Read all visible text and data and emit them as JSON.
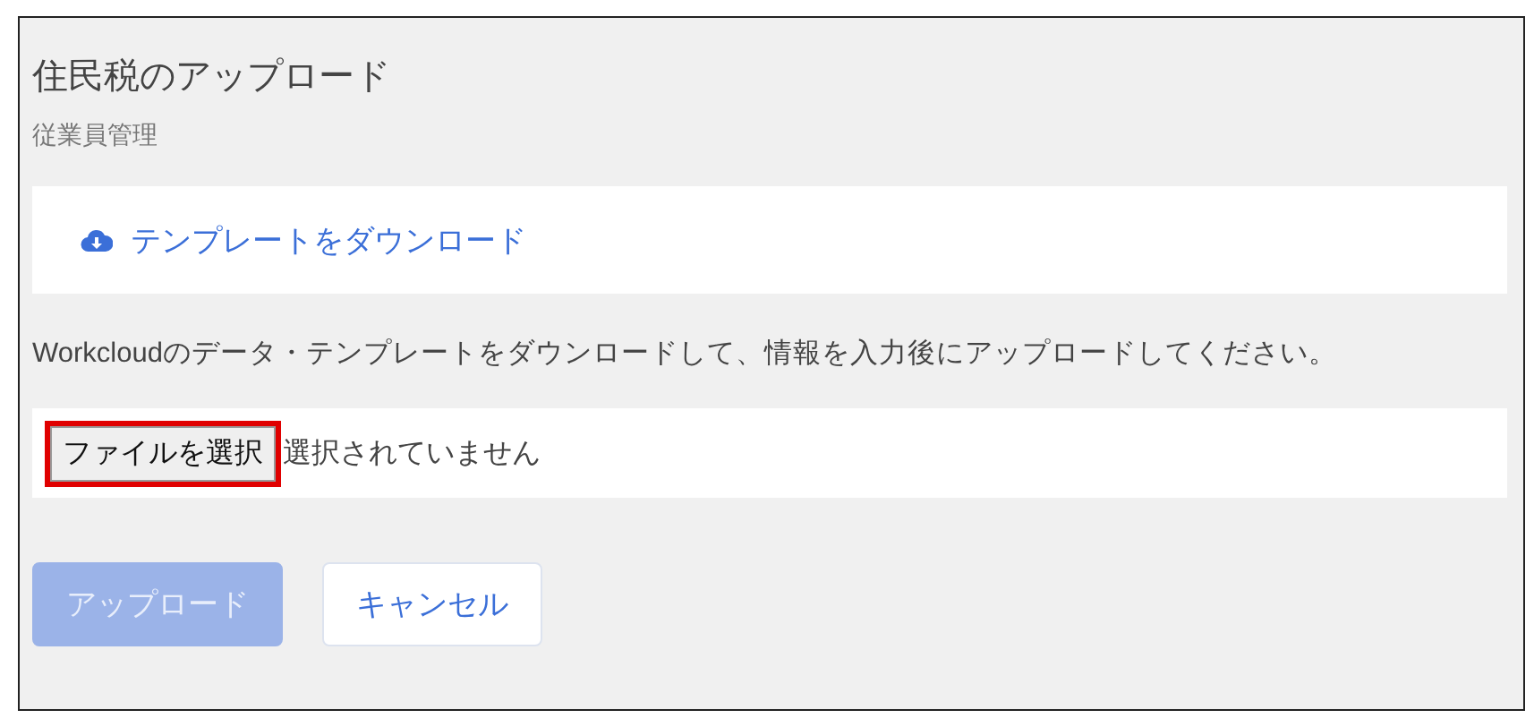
{
  "page": {
    "title": "住民税のアップロード",
    "subtitle": "従業員管理"
  },
  "download": {
    "label": "テンプレートをダウンロード"
  },
  "description": "Workcloudのデータ・テンプレートをダウンロードして、情報を入力後にアップロードしてください。",
  "file": {
    "button": "ファイルを選択",
    "highlighted": true,
    "status": "選択されていません"
  },
  "buttons": [
    {
      "label": "アップロード",
      "kind": "primary",
      "disabled": true
    },
    {
      "label": "キャンセル",
      "kind": "secondary",
      "disabled": false
    }
  ]
}
